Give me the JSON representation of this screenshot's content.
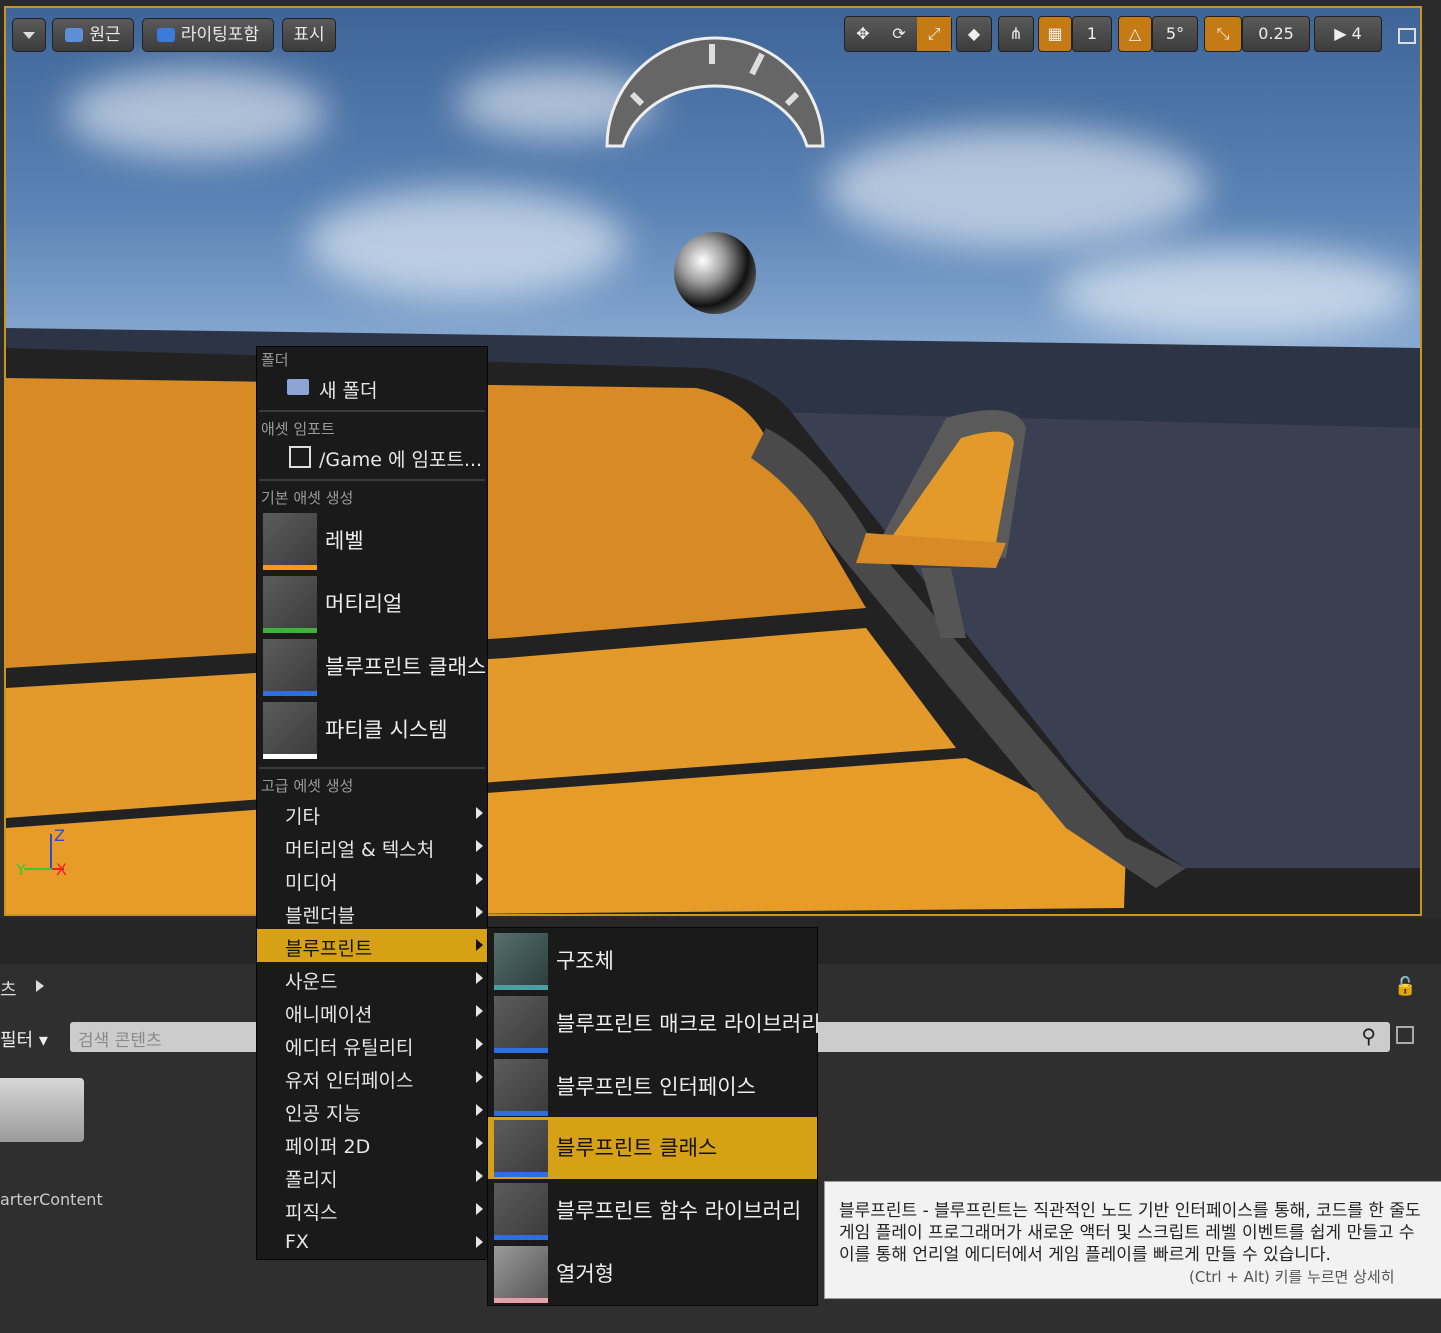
{
  "viewport": {
    "toolbar_left": [
      "원근",
      "라이팅포함",
      "표시"
    ],
    "toolbar_right": {
      "grid_value": "1",
      "rotation_value": "5°",
      "scale_value": "0.25",
      "camera_speed": "4"
    },
    "axis": {
      "z": "Z",
      "y": "Y",
      "x": "X"
    }
  },
  "context_menu": {
    "section_folder": "폴더",
    "new_folder": "새 폴더",
    "section_import": "애셋 임포트",
    "import_to": "/Game 에 임포트...",
    "section_basic": "기본 애셋 생성",
    "basic_items": [
      "레벨",
      "머티리얼",
      "블루프린트 클래스",
      "파티클 시스템"
    ],
    "section_advanced": "고급 에셋 생성",
    "advanced_items": [
      "기타",
      "머티리얼 & 텍스처",
      "미디어",
      "블렌더블",
      "블루프린트",
      "사운드",
      "애니메이션",
      "에디터 유틸리티",
      "유저 인터페이스",
      "인공 지능",
      "페이퍼 2D",
      "폴리지",
      "피직스",
      "FX"
    ],
    "highlighted": "블루프린트"
  },
  "submenu": {
    "items": [
      "구조체",
      "블루프린트 매크로 라이브러리",
      "블루프린트 인터페이스",
      "블루프린트 클래스",
      "블루프린트 함수 라이브러리",
      "열거형"
    ],
    "highlighted": "블루프린트 클래스"
  },
  "tooltip": {
    "line1": "블루프린트 - 블루프린트는 직관적인 노드 기반 인터페이스를 통해, 코드를 한 줄도",
    "line2": "게임 플레이 프로그래머가 새로운 액터 및 스크립트 레벨 이벤트를 쉽게 만들고 수",
    "line3": "이를 통해 언리얼 에디터에서 게임 플레이를 빠르게 만들 수 있습니다.",
    "hint": "(Ctrl + Alt) 키를 누르면 상세히"
  },
  "content_browser": {
    "tab_fragment": "츠",
    "filter_label": "필터",
    "search_placeholder": "검색 콘텐츠",
    "folder_name": "arterContent"
  },
  "colors": {
    "accent": "#d6a114",
    "level_bar": "#f39a1c",
    "material_bar": "#3fb23a",
    "blueprint_bar": "#2f6ee0",
    "particle_bar": "#ffffff",
    "enum_bar": "#e8a0a8"
  }
}
